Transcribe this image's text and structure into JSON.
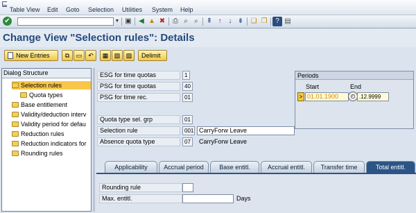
{
  "menubar": {
    "items": [
      "Table View",
      "Edit",
      "Goto",
      "Selection",
      "Utilities",
      "System",
      "Help"
    ]
  },
  "toolbar": {
    "command_value": "",
    "icons": [
      "enter-icon",
      "save-icon",
      "back-icon",
      "exit-icon",
      "cancel-icon",
      "print-icon",
      "find-icon",
      "find-next-icon",
      "first-page-icon",
      "prev-page-icon",
      "next-page-icon",
      "last-page-icon",
      "create-session-icon",
      "shortcut-icon",
      "help-icon",
      "layout-icon"
    ]
  },
  "page": {
    "title": "Change View \"Selection rules\": Details"
  },
  "app_toolbar": {
    "new_entries": "New Entries",
    "delimit": "Delimit"
  },
  "tree": {
    "header": "Dialog Structure",
    "items": [
      "Selection rules",
      "Quota types",
      "Base entitlement",
      "Validity/deduction interv",
      "Validity period for defau",
      "Reduction rules",
      "Reduction indicators for",
      "Rounding rules"
    ]
  },
  "form": {
    "esg_label": "ESG for time quotas",
    "esg_value": "1",
    "psg_quota_label": "PSG for time quotas",
    "psg_quota_value": "40",
    "psg_rec_label": "PSG for time rec.",
    "psg_rec_value": "01",
    "quota_grp_label": "Quota type sel. grp",
    "quota_grp_value": "01",
    "sel_rule_label": "Selection rule",
    "sel_rule_value": "001",
    "sel_rule_text": "CarryForw Leave",
    "absence_label": "Absence quota type",
    "absence_value": "07",
    "absence_text": "CarryForw Leave"
  },
  "periods": {
    "title": "Periods",
    "start_label": "Start",
    "end_label": "End",
    "start_value": "01.01.1900",
    "end_value": ".12.9999"
  },
  "tabs": [
    "Applicability",
    "Accrual period",
    "Base entitl.",
    "Accrual entitl.",
    "Transfer time",
    "Total entitl."
  ],
  "panel": {
    "rounding_label": "Rounding rule",
    "rounding_value": "",
    "max_label": "Max. entitl.",
    "max_value": "",
    "days_unit": "Days"
  },
  "colors": {
    "title": "#254a7c",
    "active_tab": "#2c5486",
    "selected_tree": "#f7c64a"
  }
}
